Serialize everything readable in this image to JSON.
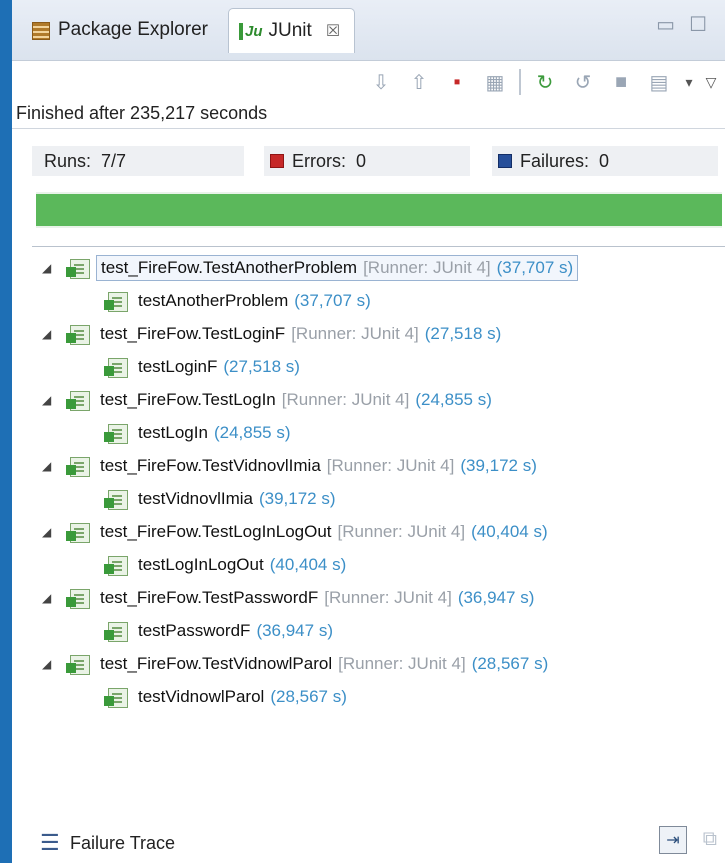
{
  "tabs": {
    "package_explorer": "Package Explorer",
    "junit": "JUnit",
    "close": "☒",
    "minimize": "▭",
    "maximize": "☐"
  },
  "toolbar": {
    "icons": [
      "next-failure-icon",
      "previous-failure-icon",
      "show-failures-only-icon",
      "scroll-lock-icon",
      "rerun-icon",
      "rerun-failed-first-icon",
      "stop-icon",
      "test-run-history-icon",
      "view-menu-icon"
    ]
  },
  "status": "Finished after 235,217 seconds",
  "counters": {
    "runs_label": "Runs:",
    "runs_value": "7/7",
    "errors_label": "Errors:",
    "errors_value": "0",
    "failures_label": "Failures:",
    "failures_value": "0"
  },
  "progress": {
    "fraction": 1.0,
    "color": "#5bb85b"
  },
  "tree": [
    {
      "suite": "test_FireFow.TestAnotherProblem",
      "runner": "[Runner: JUnit 4]",
      "time": "(37,707 s)",
      "case": "testAnotherProblem",
      "case_time": "(37,707 s)"
    },
    {
      "suite": "test_FireFow.TestLoginF",
      "runner": "[Runner: JUnit 4]",
      "time": "(27,518 s)",
      "case": "testLoginF",
      "case_time": "(27,518 s)"
    },
    {
      "suite": "test_FireFow.TestLogIn",
      "runner": "[Runner: JUnit 4]",
      "time": "(24,855 s)",
      "case": "testLogIn",
      "case_time": "(24,855 s)"
    },
    {
      "suite": "test_FireFow.TestVidnovlImia",
      "runner": "[Runner: JUnit 4]",
      "time": "(39,172 s)",
      "case": "testVidnovlImia",
      "case_time": "(39,172 s)"
    },
    {
      "suite": "test_FireFow.TestLogInLogOut",
      "runner": "[Runner: JUnit 4]",
      "time": "(40,404 s)",
      "case": "testLogInLogOut",
      "case_time": "(40,404 s)"
    },
    {
      "suite": "test_FireFow.TestPasswordF",
      "runner": "[Runner: JUnit 4]",
      "time": "(36,947 s)",
      "case": "testPasswordF",
      "case_time": "(36,947 s)"
    },
    {
      "suite": "test_FireFow.TestVidnowlParol",
      "runner": "[Runner: JUnit 4]",
      "time": "(28,567 s)",
      "case": "testVidnowlParol",
      "case_time": "(28,567 s)"
    }
  ],
  "failure_trace": {
    "label": "Failure Trace"
  },
  "colors": {
    "accent": "#3c8fc7",
    "success": "#5bb85b",
    "error": "#c62828",
    "failure": "#274f9a"
  }
}
